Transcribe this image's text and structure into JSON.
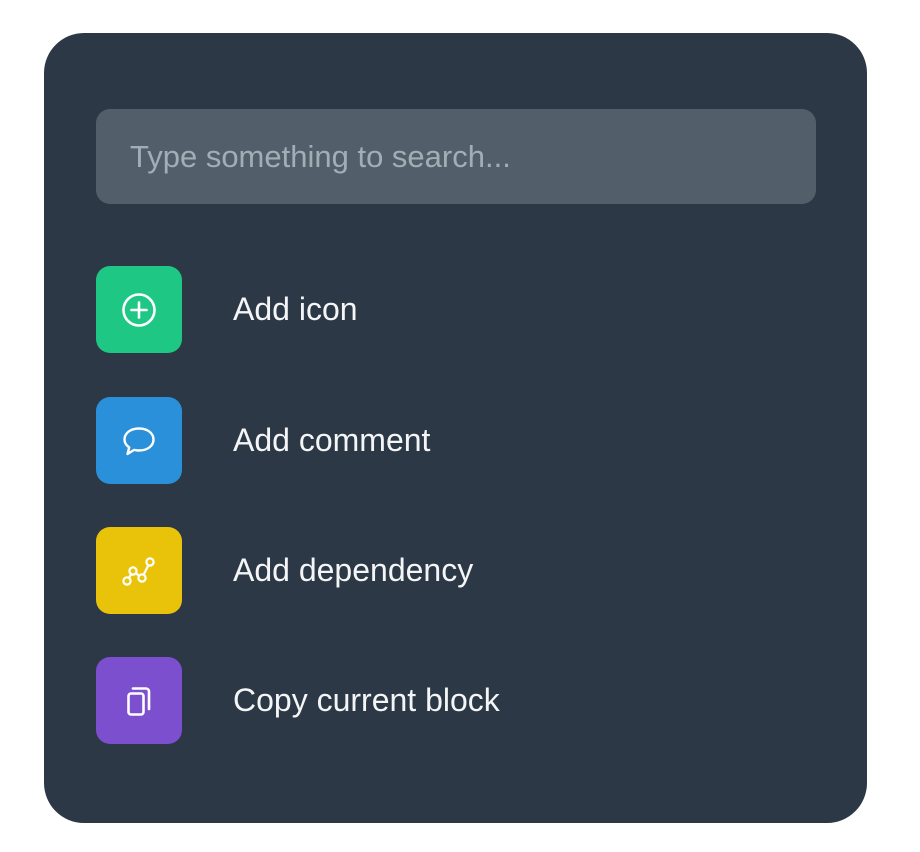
{
  "search": {
    "placeholder": "Type something to search...",
    "value": ""
  },
  "menu": {
    "items": [
      {
        "label": "Add icon",
        "icon": "plus-circle-icon",
        "color": "#1fc784"
      },
      {
        "label": "Add comment",
        "icon": "speech-bubble-icon",
        "color": "#2a90da"
      },
      {
        "label": "Add dependency",
        "icon": "graph-nodes-icon",
        "color": "#e9c30a"
      },
      {
        "label": "Copy current block",
        "icon": "copy-icon",
        "color": "#7c4fcf"
      }
    ]
  },
  "colors": {
    "panel_background": "#2c3845",
    "search_background": "#525f6a",
    "text": "#f3f5f7",
    "placeholder_text": "#a3adb5"
  }
}
